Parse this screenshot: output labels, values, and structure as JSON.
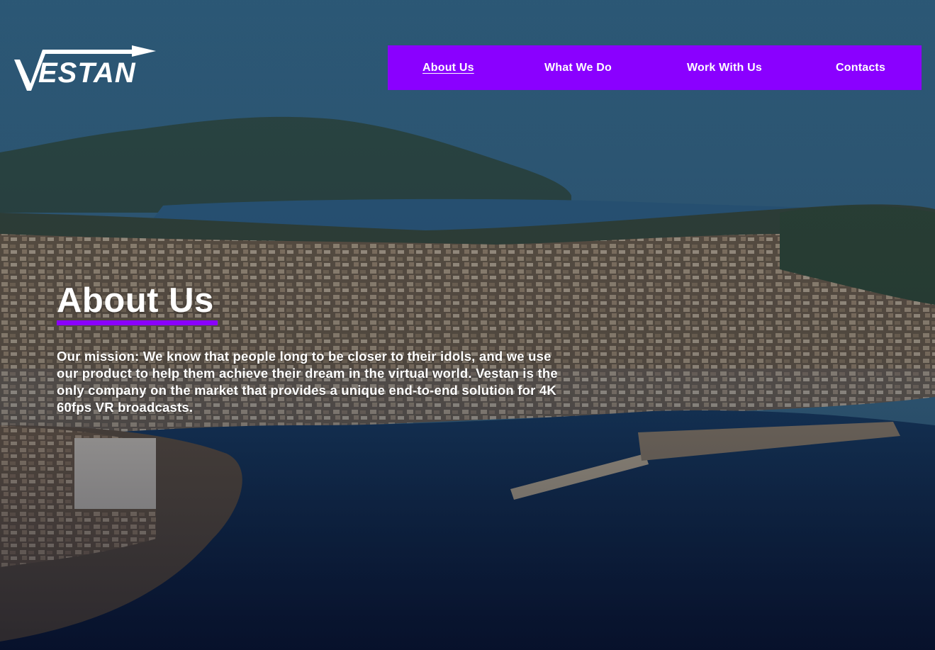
{
  "brand": {
    "logo_text": "VESTAN",
    "accent_color": "#8a00ff"
  },
  "nav": {
    "items": [
      {
        "label": "About Us",
        "active": true
      },
      {
        "label": "What We Do",
        "active": false
      },
      {
        "label": "Work With Us",
        "active": false
      },
      {
        "label": "Contacts",
        "active": false
      }
    ]
  },
  "hero": {
    "title": "About Us",
    "mission": "Our mission: We know that people long to be closer to their idols, and we use our product to help them achieve their dream in the virtual world. Vestan is the only company on the market that provides a unique end-to-end solution for 4K 60fps VR broadcasts.",
    "background": "aerial-coastal-town-photo"
  }
}
